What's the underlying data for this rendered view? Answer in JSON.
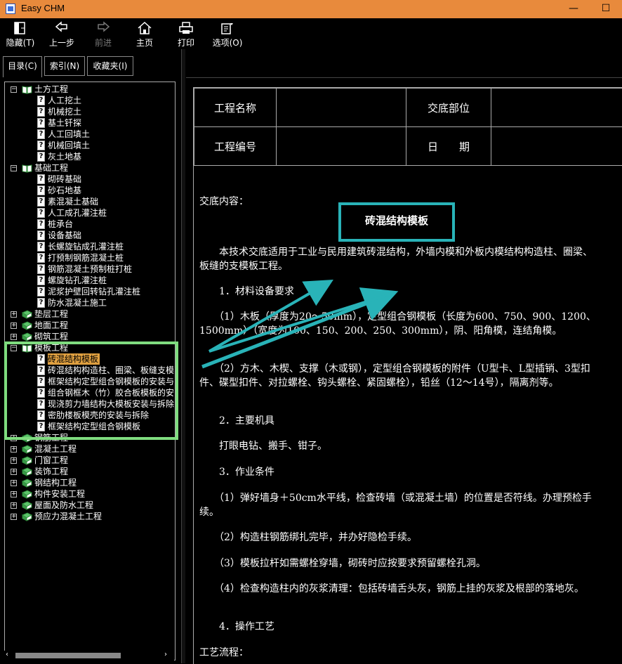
{
  "window": {
    "title": "Easy CHM",
    "minimize": "—",
    "maximize": "☐"
  },
  "toolbar": {
    "hide": "隐藏(T)",
    "back": "上一步",
    "forward": "前进",
    "home": "主页",
    "print": "打印",
    "options": "选项(O)"
  },
  "tabs": [
    "目录(C)",
    "索引(N)",
    "收藏夹(I)"
  ],
  "tree": [
    {
      "label": "土方工程",
      "level": 0,
      "type": "book",
      "state": "open"
    },
    {
      "label": "人工挖土",
      "level": 1,
      "type": "page"
    },
    {
      "label": "机械挖土",
      "level": 1,
      "type": "page"
    },
    {
      "label": "基土钎探",
      "level": 1,
      "type": "page"
    },
    {
      "label": "人工回填土",
      "level": 1,
      "type": "page"
    },
    {
      "label": "机械回填土",
      "level": 1,
      "type": "page"
    },
    {
      "label": "灰土地基",
      "level": 1,
      "type": "page"
    },
    {
      "label": "基础工程",
      "level": 0,
      "type": "book",
      "state": "open"
    },
    {
      "label": "砌砖基础",
      "level": 1,
      "type": "page"
    },
    {
      "label": "砂石地基",
      "level": 1,
      "type": "page"
    },
    {
      "label": "素混凝土基础",
      "level": 1,
      "type": "page"
    },
    {
      "label": "人工成孔灌注桩",
      "level": 1,
      "type": "page"
    },
    {
      "label": "桩承台",
      "level": 1,
      "type": "page"
    },
    {
      "label": "设备基础",
      "level": 1,
      "type": "page"
    },
    {
      "label": "长螺旋钻成孔灌注桩",
      "level": 1,
      "type": "page"
    },
    {
      "label": "打预制钢筋混凝土桩",
      "level": 1,
      "type": "page"
    },
    {
      "label": "钢筋混凝土预制桩打桩",
      "level": 1,
      "type": "page"
    },
    {
      "label": "螺旋钻孔灌注桩",
      "level": 1,
      "type": "page"
    },
    {
      "label": "泥浆护壁回转钻孔灌注桩",
      "level": 1,
      "type": "page"
    },
    {
      "label": "防水混凝土施工",
      "level": 1,
      "type": "page"
    },
    {
      "label": "垫层工程",
      "level": 0,
      "type": "book",
      "state": "closed"
    },
    {
      "label": "地面工程",
      "level": 0,
      "type": "book",
      "state": "closed"
    },
    {
      "label": "砌筑工程",
      "level": 0,
      "type": "book",
      "state": "closed"
    },
    {
      "label": "模板工程",
      "level": 0,
      "type": "book",
      "state": "open"
    },
    {
      "label": "砖混结构模板",
      "level": 1,
      "type": "page",
      "selected": true
    },
    {
      "label": "砖混结构构造柱、圈梁、板缝支模",
      "level": 1,
      "type": "page"
    },
    {
      "label": "框架结构定型组合钢模板的安装与",
      "level": 1,
      "type": "page"
    },
    {
      "label": "组合钢框木（竹）胶合板模板的安",
      "level": 1,
      "type": "page"
    },
    {
      "label": "现浇剪力墙结构大模板安装与拆除",
      "level": 1,
      "type": "page"
    },
    {
      "label": "密肋楼板模壳的安装与拆除",
      "level": 1,
      "type": "page"
    },
    {
      "label": "框架结构定型组合钢模板",
      "level": 1,
      "type": "page"
    },
    {
      "label": "钢筋工程",
      "level": 0,
      "type": "book",
      "state": "closed"
    },
    {
      "label": "混凝土工程",
      "level": 0,
      "type": "book",
      "state": "closed"
    },
    {
      "label": "门窗工程",
      "level": 0,
      "type": "book",
      "state": "closed"
    },
    {
      "label": "装饰工程",
      "level": 0,
      "type": "book",
      "state": "closed"
    },
    {
      "label": "钢结构工程",
      "level": 0,
      "type": "book",
      "state": "closed"
    },
    {
      "label": "构件安装工程",
      "level": 0,
      "type": "book",
      "state": "closed"
    },
    {
      "label": "屋面及防水工程",
      "level": 0,
      "type": "book",
      "state": "closed"
    },
    {
      "label": "预应力混凝土工程",
      "level": 0,
      "type": "book",
      "state": "closed"
    }
  ],
  "doc": {
    "header": {
      "project_name_label": "工程名称",
      "position_label": "交底部位",
      "project_no_label": "工程编号",
      "date_label": "日　　期"
    },
    "intro_label": "交底内容：",
    "title": "砖混结构模板",
    "paragraphs": [
      "　　本技术交底适用于工业与民用建筑砖混结构，外墙内模和外板内模结构构造柱、圈梁、板缝的支模板工程。",
      "　　1．材料设备要求",
      "　　（1）木板（厚度为20～50mm），定型组合钢模板（长度为600、750、900、1200、1500mm）（宽度为100、150、200、250、300mm），阴、阳角模，连结角模。",
      "　　（2）方木、木楔、支撑（木或钢），定型组合钢模板的附件（U型卡、L型插销、3型扣件、碟型扣件、对拉螺栓、钩头螺栓、紧固螺栓），铅丝（12～14号），隔离剂等。",
      "　　2．主要机具",
      "　　打眼电钻、搬手、钳子。",
      "　　3．作业条件",
      "　　（1）弹好墙身＋50cm水平线，检查砖墙（或混凝土墙）的位置是否符线。办理预检手续。",
      "　　（2）构造柱钢筋绑扎完毕，并办好隐检手续。",
      "　　（3）模板拉杆如需螺栓穿墙，砌砖时应按要求预留螺栓孔洞。",
      "　　（4）检查构造柱内的灰浆清理：包括砖墙舌头灰，钢筋上挂的灰浆及根部的落地灰。",
      "　　4．操作工艺",
      "工艺流程："
    ]
  }
}
